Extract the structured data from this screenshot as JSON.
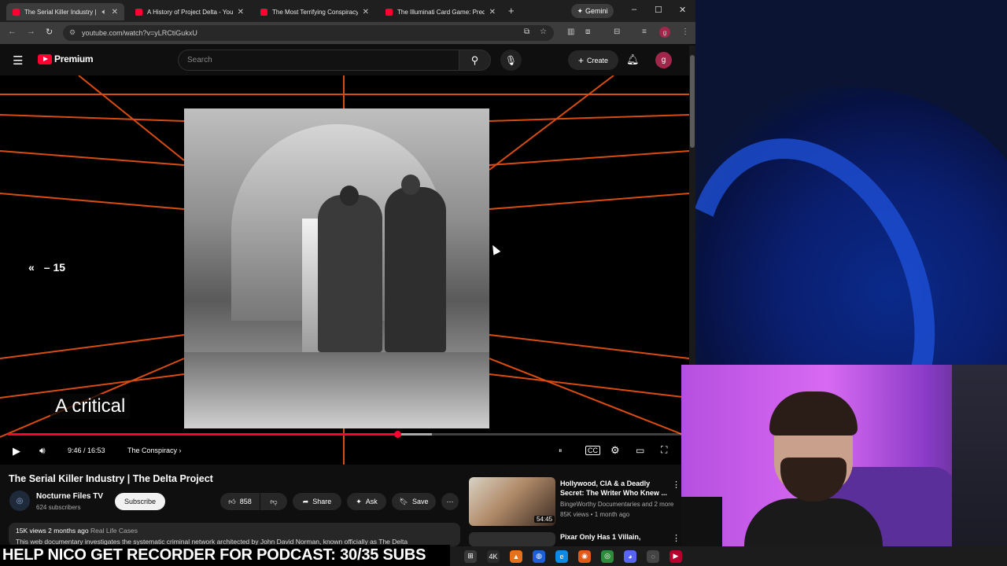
{
  "browser": {
    "tabs": [
      {
        "title": "The Serial Killer Industry | T",
        "active": true
      },
      {
        "title": "A History of Project Delta - You",
        "active": false
      },
      {
        "title": "The Most Terrifying Conspiracy",
        "active": false
      },
      {
        "title": "The Illuminati Card Game: Predi",
        "active": false
      }
    ],
    "new_tab": "+",
    "gemini_label": "Gemini",
    "url": "youtube.com/watch?v=yLRCtiGukxU",
    "window_controls": {
      "minimize": "–",
      "maximize": "☐",
      "close": "✕"
    }
  },
  "youtube": {
    "logo_text": "Premium",
    "search_placeholder": "Search",
    "create_label": "Create",
    "avatar_letter": "g"
  },
  "player": {
    "seek_back_label": "– 15",
    "caption": "A critical",
    "time": "9:46 / 16:53",
    "chapter": "The Conspiracy",
    "progress_fraction": 0.578
  },
  "video": {
    "title": "The Serial Killer Industry | The Delta Project",
    "channel": "Nocturne Files TV",
    "subscribers": "624 subscribers",
    "subscribe_label": "Subscribe",
    "likes": "858",
    "share_label": "Share",
    "ask_label": "Ask",
    "save_label": "Save",
    "views_line": "15K views  2 months ago",
    "tag": "Real Life Cases",
    "description_snippet": "This web documentary investigates the systematic criminal network architected by John David Norman, known officially as The Delta"
  },
  "recommendations": [
    {
      "title": "Hollywood, CIA & a Deadly Secret: The Writer Who Knew ...",
      "channel": "BingeWorthy Documentaries and 2 more",
      "meta": "85K views • 1 month ago",
      "duration": "54:45"
    },
    {
      "title": "Pixar Only Has 1 Villain,"
    }
  ],
  "stream_banner": "HELP NICO GET RECORDER FOR PODCAST: 30/35 SUBS",
  "colors": {
    "accent": "#ff0033",
    "background": "#0f0f0f",
    "grid": "#ff5a14"
  }
}
